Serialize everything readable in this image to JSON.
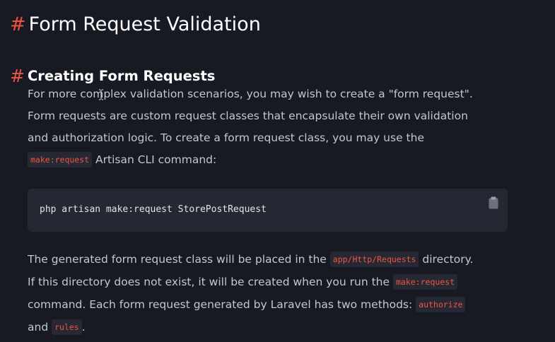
{
  "page": {
    "title_hash": "#",
    "title": "Form Request Validation"
  },
  "section": {
    "heading_hash": "#",
    "heading": "Creating Form Requests",
    "para1": {
      "line1": "For more complex validation scenarios, you may wish to create a \"form request\".",
      "line2": "Form requests are custom request classes that encapsulate their own validation",
      "line3": "and authorization logic. To create a form request class, you may use the",
      "line4_code": "make:request",
      "line4_text": " Artisan CLI command:"
    },
    "code_block": {
      "code": "php artisan make:request StorePostRequest",
      "copy_icon": "clipboard-icon"
    },
    "para2": {
      "line1_text": "The generated form request class will be placed in the ",
      "line1_code": "app/Http/Requests",
      "line1_end": " directory.",
      "line2_text": "If this directory does not exist, it will be created when you run the ",
      "line2_code": "make:request",
      "line3_text": "command. Each form request generated by Laravel has two methods: ",
      "line3_code": "authorize",
      "line4_text": "and ",
      "line4_code": "rules",
      "line4_end": "."
    }
  },
  "colors": {
    "background": "#171923",
    "accent": "#f05340",
    "text": "#c3c6d3",
    "code_bg": "#252833"
  }
}
